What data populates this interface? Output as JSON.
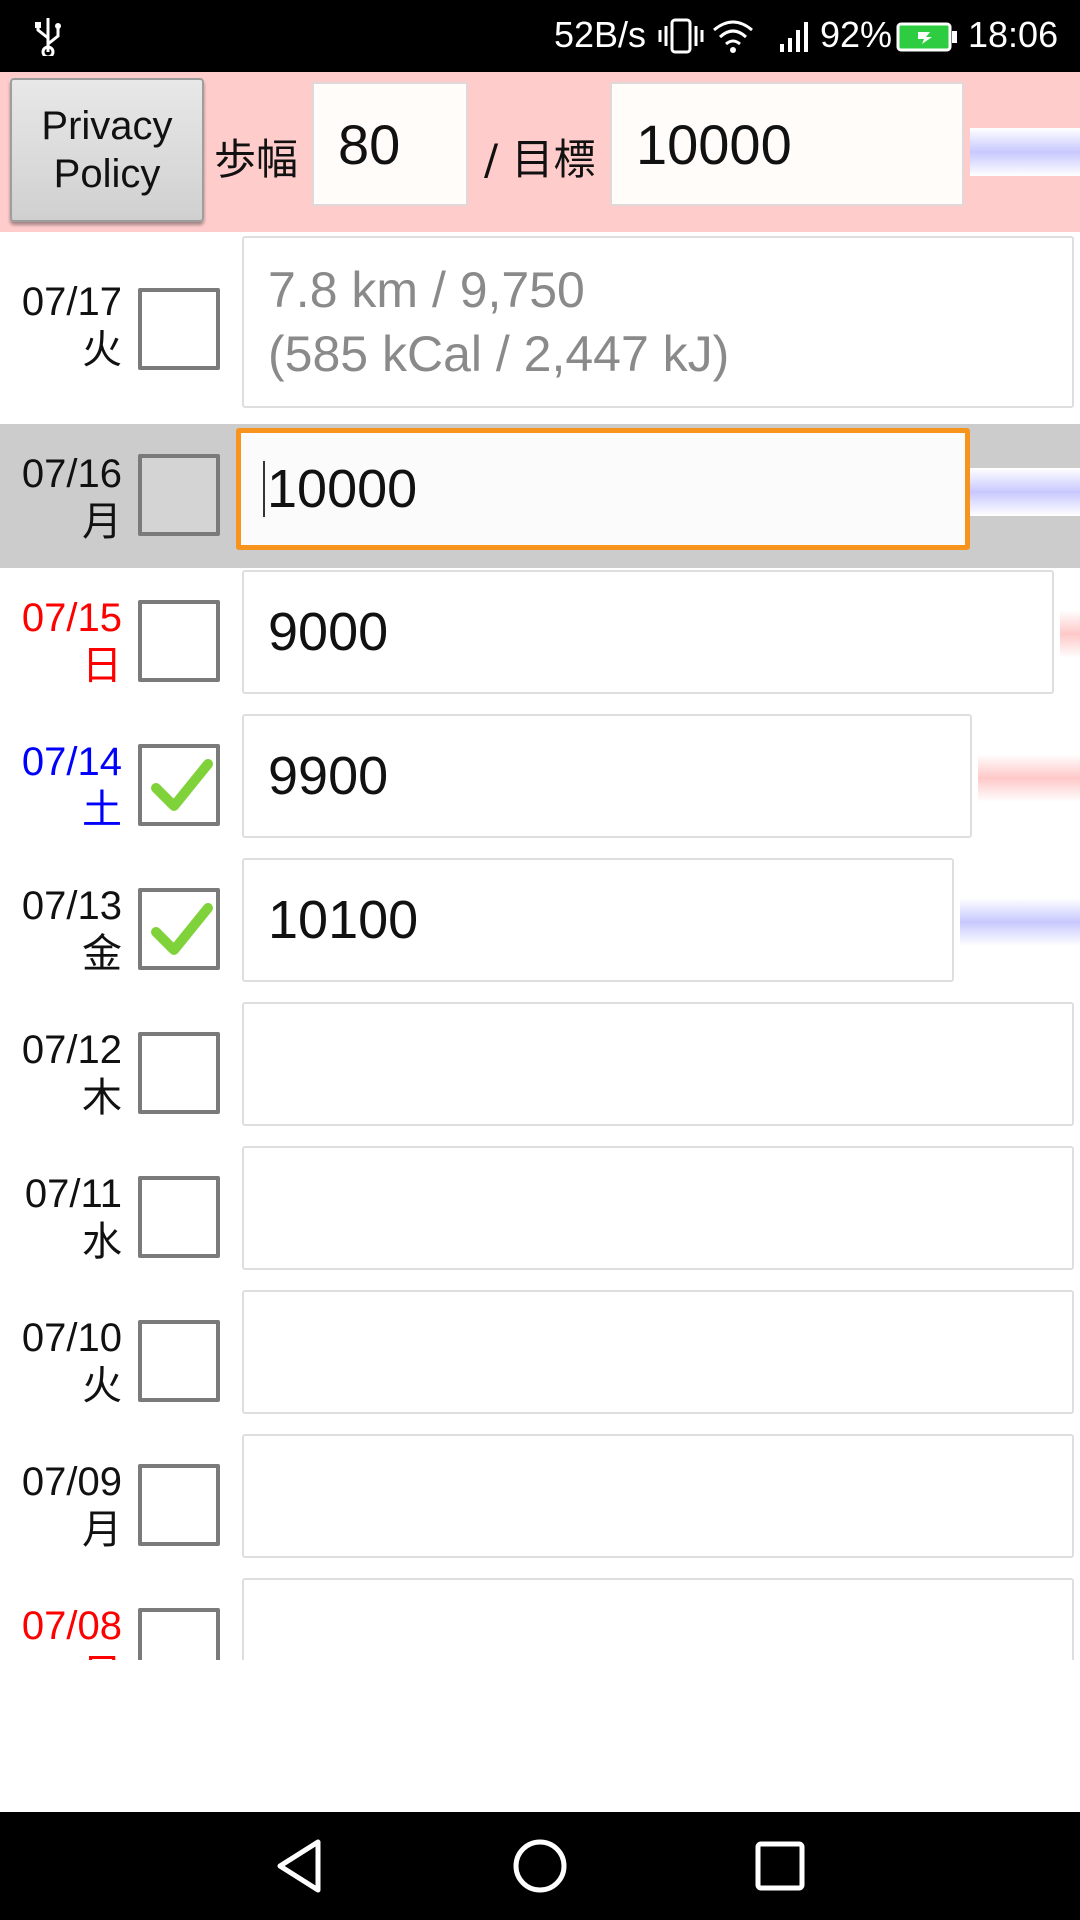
{
  "status_bar": {
    "net_speed": "52B/s",
    "battery": "92%",
    "time": "18:06",
    "icons": [
      "usb-icon",
      "vibrate-icon",
      "wifi-icon",
      "signal-icon",
      "battery-icon"
    ]
  },
  "header": {
    "privacy_label": "Privacy\nPolicy",
    "stride_label": "歩幅",
    "stride_value": "80",
    "goal_label": "/ 目標",
    "goal_value": "10000"
  },
  "rows": [
    {
      "date": "07/17",
      "weekday": "火",
      "checked": false,
      "value": "",
      "hint": "7.8 km / 9,750\n(585 kCal / 2,447 kJ)"
    },
    {
      "date": "07/16",
      "weekday": "月",
      "checked": false,
      "value": "10000",
      "focused": true
    },
    {
      "date": "07/15",
      "weekday": "日",
      "checked": false,
      "value": "9000"
    },
    {
      "date": "07/14",
      "weekday": "土",
      "checked": true,
      "value": "9900"
    },
    {
      "date": "07/13",
      "weekday": "金",
      "checked": true,
      "value": "10100"
    },
    {
      "date": "07/12",
      "weekday": "木",
      "checked": false,
      "value": ""
    },
    {
      "date": "07/11",
      "weekday": "水",
      "checked": false,
      "value": ""
    },
    {
      "date": "07/10",
      "weekday": "火",
      "checked": false,
      "value": ""
    },
    {
      "date": "07/09",
      "weekday": "月",
      "checked": false,
      "value": ""
    },
    {
      "date": "07/08",
      "weekday": "日",
      "checked": false,
      "value": ""
    }
  ],
  "colors": {
    "header_bg": "#ffcccc",
    "sunday": "#ff0000",
    "saturday": "#0000ff",
    "focus": "#f7941d",
    "selected_row": "#cccccc"
  },
  "nav_bar": {
    "icons": [
      "back-icon",
      "home-icon",
      "recents-icon"
    ]
  }
}
